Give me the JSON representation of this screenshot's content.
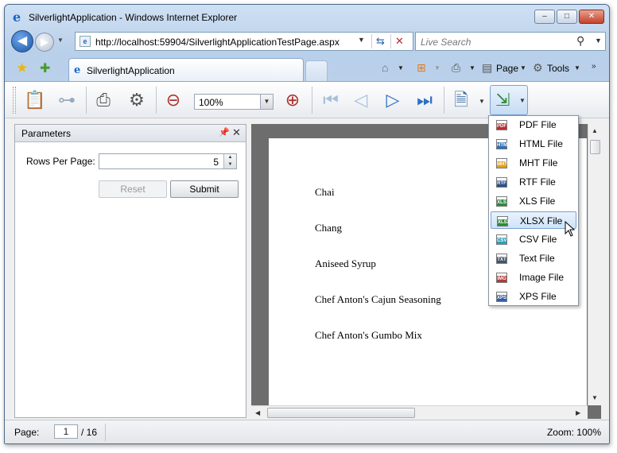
{
  "window": {
    "title": "SilverlightApplication - Windows Internet Explorer",
    "controls": {
      "minimize": "–",
      "maximize": "□",
      "close": "✕"
    }
  },
  "nav": {
    "address": "http://localhost:59904/SilverlightApplicationTestPage.aspx",
    "search_placeholder": "Live Search"
  },
  "tabs": {
    "active_tab": "SilverlightApplication",
    "page_menu": "Page",
    "tools_menu": "Tools"
  },
  "toolbar": {
    "zoom_value": "100%",
    "icons": [
      "parameters-icon",
      "document-map-icon",
      "print-icon",
      "page-setup-icon",
      "zoom-out-icon",
      "zoom-in-icon",
      "first-page-icon",
      "previous-page-icon",
      "next-page-icon",
      "last-page-icon",
      "save-icon",
      "export-icon"
    ]
  },
  "parameters_panel": {
    "title": "Parameters",
    "rows_label": "Rows Per Page:",
    "rows_value": "5",
    "reset_label": "Reset",
    "submit_label": "Submit"
  },
  "report": {
    "items": [
      "Chai",
      "Chang",
      "Aniseed Syrup",
      "Chef Anton's Cajun Seasoning",
      "Chef Anton's Gumbo Mix"
    ]
  },
  "export_menu": {
    "hovered_index": 5,
    "items": [
      {
        "label": "PDF File",
        "tag": "PDF",
        "color": "#c0282e"
      },
      {
        "label": "HTML File",
        "tag": "HTML",
        "color": "#2f6fb5"
      },
      {
        "label": "MHT File",
        "tag": "MHT",
        "color": "#e0a020"
      },
      {
        "label": "RTF File",
        "tag": "RTF",
        "color": "#2b4f8c"
      },
      {
        "label": "XLS File",
        "tag": "XLS",
        "color": "#2e8b3a"
      },
      {
        "label": "XLSX File",
        "tag": "XLSX",
        "color": "#2e8b3a"
      },
      {
        "label": "CSV File",
        "tag": "CSV",
        "color": "#2aa1b5"
      },
      {
        "label": "Text File",
        "tag": "TXT",
        "color": "#44546a"
      },
      {
        "label": "Image File",
        "tag": "IMG",
        "color": "#b23a3a"
      },
      {
        "label": "XPS File",
        "tag": "XPS",
        "color": "#2f5fa5"
      }
    ]
  },
  "statusbar": {
    "page_label": "Page:",
    "current_page": "1",
    "total_pages": "/ 16",
    "zoom": "Zoom: 100%"
  }
}
